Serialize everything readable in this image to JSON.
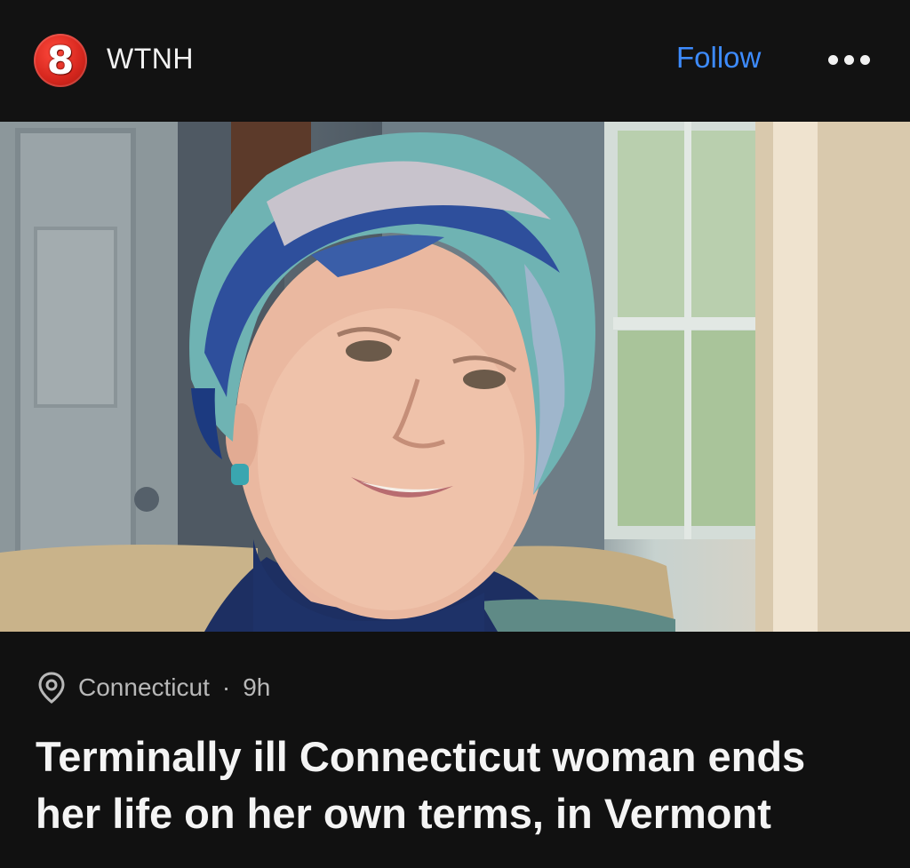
{
  "header": {
    "logo_text": "8",
    "source_name": "WTNH",
    "follow_label": "Follow",
    "more_icon": "more-horizontal-icon"
  },
  "hero": {
    "image_subject": "smiling elderly woman in a blue patterned head wrap"
  },
  "meta": {
    "location_icon": "location-pin-icon",
    "location": "Connecticut",
    "separator": "·",
    "time_ago": "9h"
  },
  "article": {
    "headline": "Terminally ill Connecticut woman ends her life on her own terms, in Vermont"
  },
  "colors": {
    "background": "#111111",
    "accent": "#3d8bfd",
    "logo_red": "#d8281f",
    "meta_text": "#b8b8b8"
  }
}
